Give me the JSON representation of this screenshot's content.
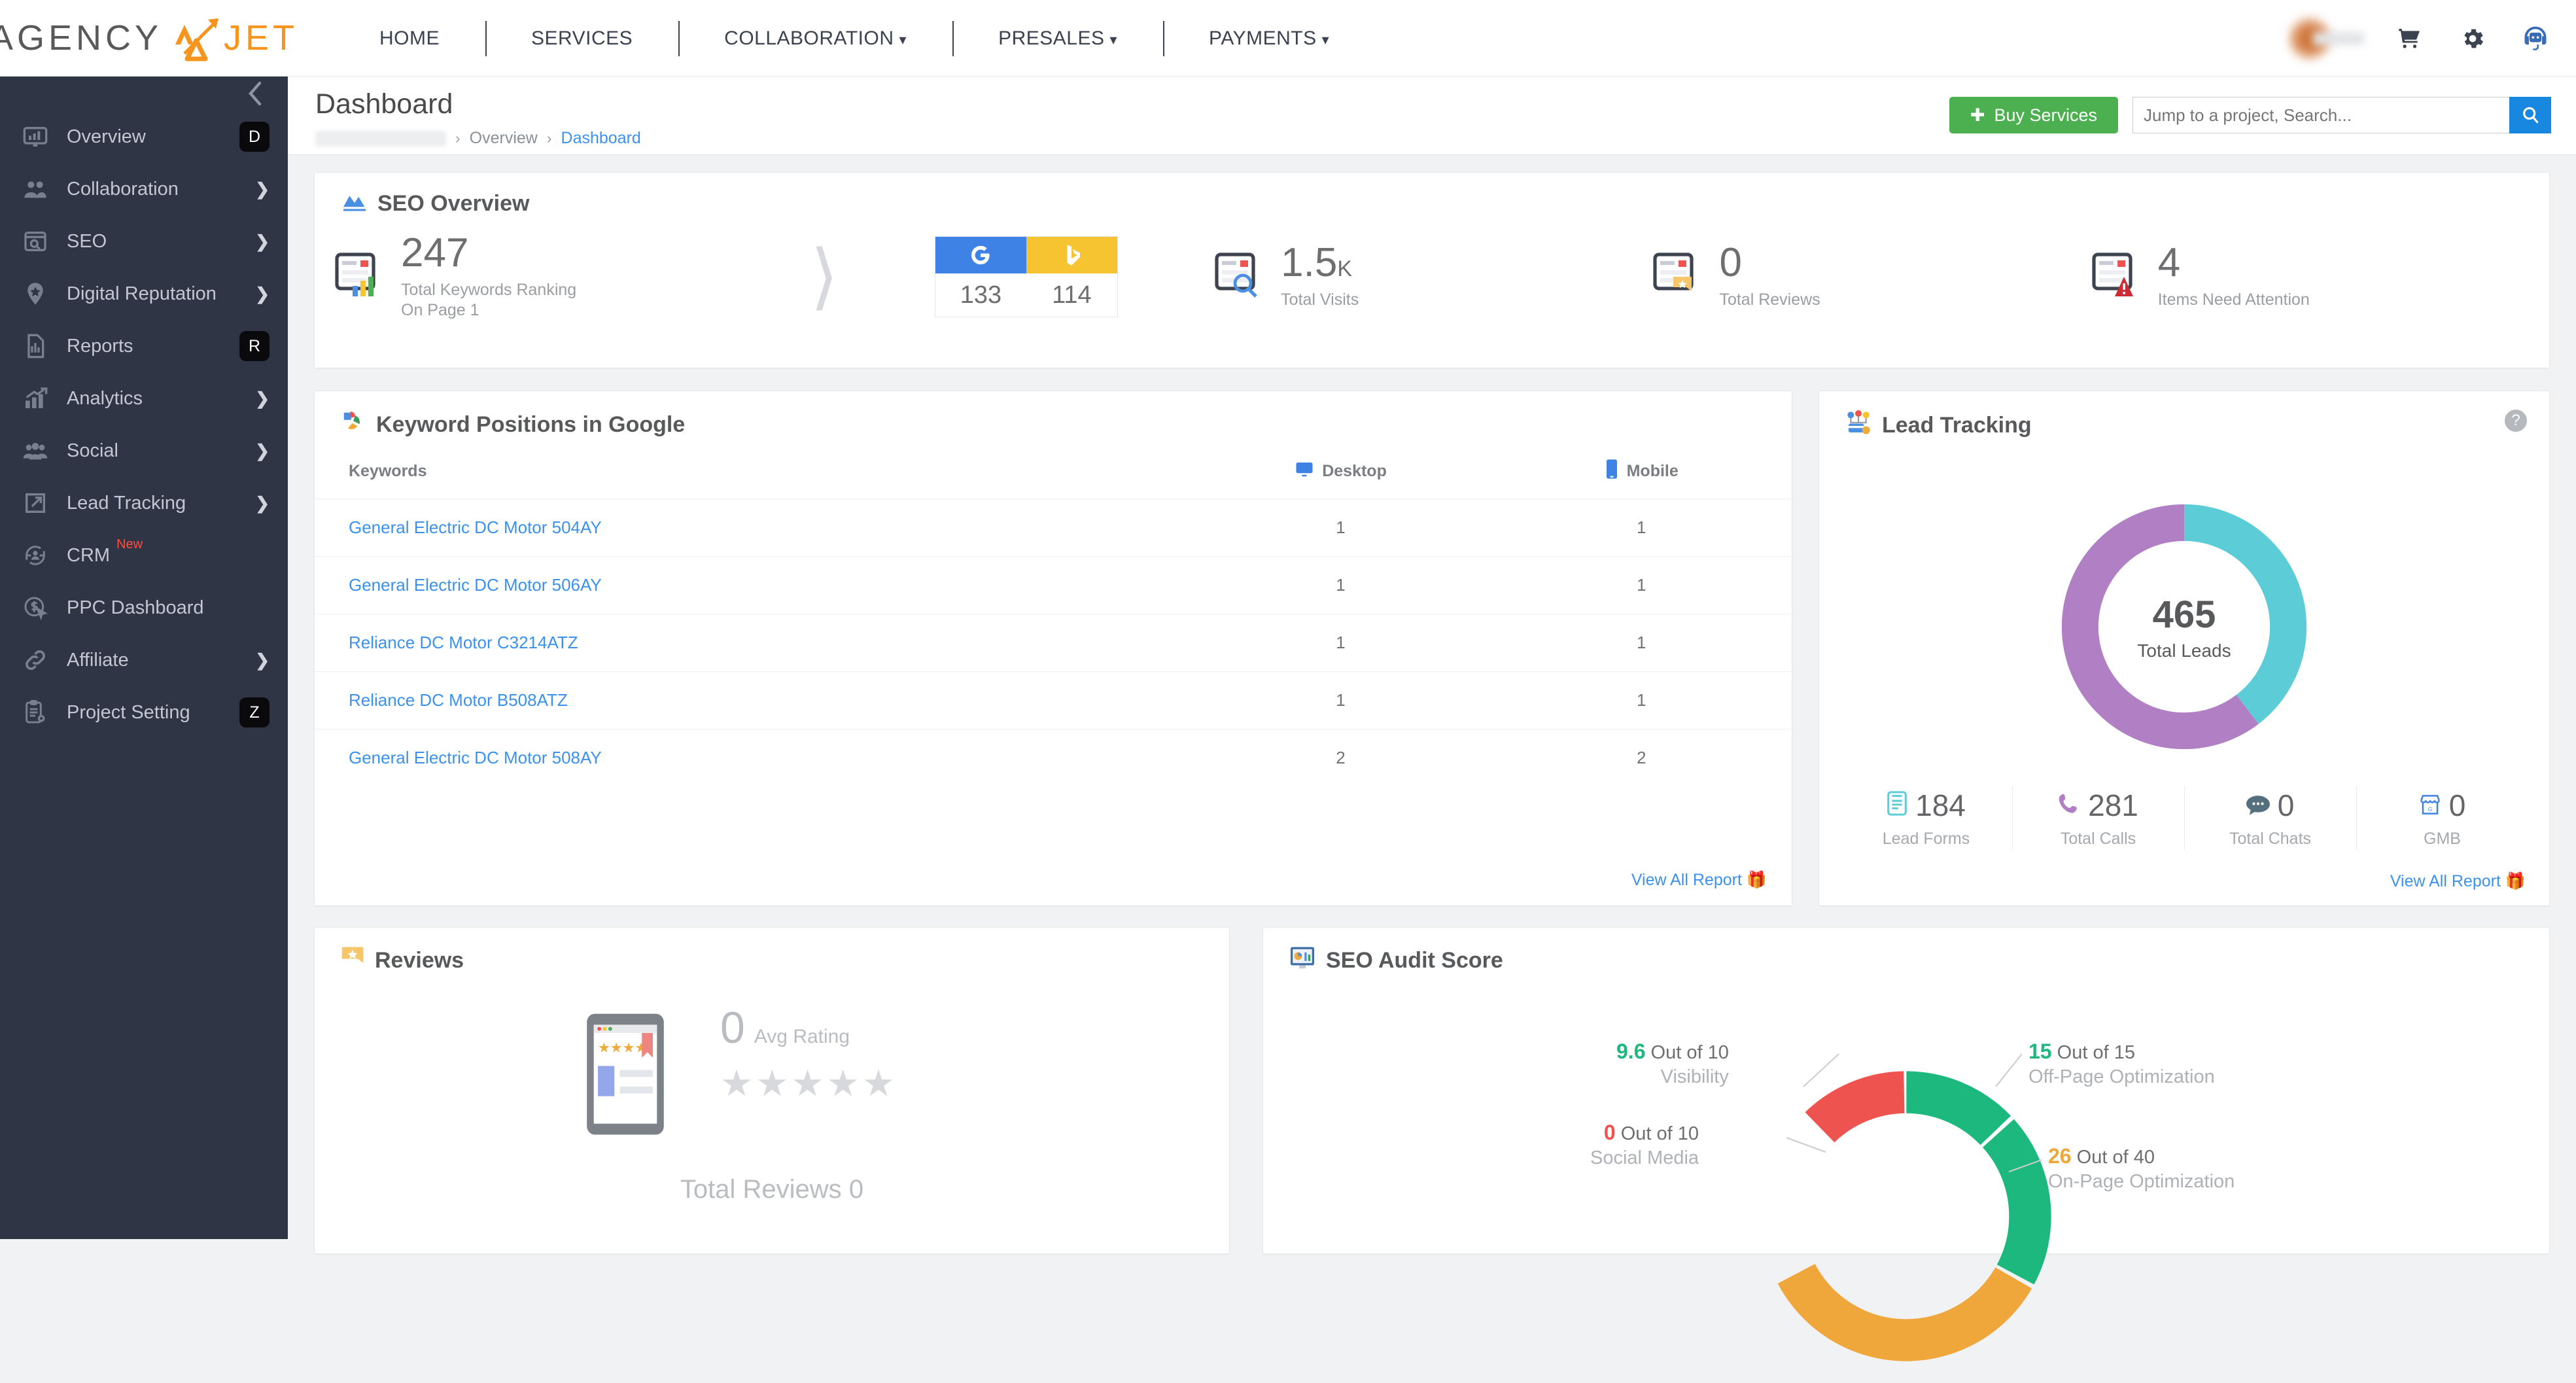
{
  "brand": {
    "name_dark": "AGENCY",
    "name_orange": "JET"
  },
  "topnav": {
    "items": [
      {
        "label": "HOME",
        "has_caret": false
      },
      {
        "label": "SERVICES",
        "has_caret": false
      },
      {
        "label": "COLLABORATION",
        "has_caret": true
      },
      {
        "label": "PRESALES",
        "has_caret": true
      },
      {
        "label": "PAYMENTS",
        "has_caret": true
      }
    ],
    "icons": [
      "cart-icon",
      "gear-icon",
      "support-headset-icon"
    ]
  },
  "sidebar": {
    "collapse_icon": "chevron-left-icon",
    "items": [
      {
        "label": "Overview",
        "icon": "monitor-chart-icon",
        "key": "D",
        "chevron": false
      },
      {
        "label": "Collaboration",
        "icon": "users-icon",
        "key": null,
        "chevron": true
      },
      {
        "label": "SEO",
        "icon": "browser-search-icon",
        "key": null,
        "chevron": true
      },
      {
        "label": "Digital Reputation",
        "icon": "star-pin-icon",
        "key": null,
        "chevron": true
      },
      {
        "label": "Reports",
        "icon": "file-chart-icon",
        "key": "R",
        "chevron": false
      },
      {
        "label": "Analytics",
        "icon": "growth-chart-icon",
        "key": null,
        "chevron": true
      },
      {
        "label": "Social",
        "icon": "group-icon",
        "key": null,
        "chevron": true
      },
      {
        "label": "Lead Tracking",
        "icon": "arrow-out-icon",
        "key": null,
        "chevron": true
      },
      {
        "label": "CRM",
        "icon": "crm-cycle-icon",
        "key": null,
        "chevron": false,
        "badge": "New"
      },
      {
        "label": "PPC Dashboard",
        "icon": "dollar-click-icon",
        "key": null,
        "chevron": false
      },
      {
        "label": "Affiliate",
        "icon": "link-icon",
        "key": null,
        "chevron": true
      },
      {
        "label": "Project Setting",
        "icon": "clipboard-gear-icon",
        "key": "Z",
        "chevron": false
      }
    ]
  },
  "pagehead": {
    "title": "Dashboard",
    "breadcrumb": {
      "project_redacted": "",
      "sep": "›",
      "overview": "Overview",
      "current": "Dashboard"
    },
    "buy_button": "Buy Services",
    "buy_icon": "plus-icon",
    "search": {
      "placeholder": "Jump to a project, Search...",
      "value": "",
      "icon": "search-icon"
    }
  },
  "seo_overview": {
    "title": "SEO Overview",
    "icon": "area-chart-icon",
    "keywords": {
      "value": "247",
      "label_line1": "Total Keywords Ranking",
      "label_line2": "On Page 1",
      "icon": "page-bars-icon"
    },
    "engines": {
      "google": {
        "icon": "google-g-icon",
        "value": "133",
        "color": "#3d82e4"
      },
      "bing": {
        "icon": "bing-b-icon",
        "value": "114",
        "color": "#f5c430"
      }
    },
    "visits": {
      "value": "1.5",
      "unit": "K",
      "label": "Total Visits",
      "icon": "page-search-icon"
    },
    "reviews": {
      "value": "0",
      "label": "Total Reviews",
      "icon": "page-star-icon"
    },
    "attention": {
      "value": "4",
      "label": "Items Need Attention",
      "icon": "page-warning-icon"
    }
  },
  "keyword_card": {
    "title": "Keyword Positions in Google",
    "icon": "google-colored-icon",
    "columns": [
      {
        "label": "Keywords",
        "icon": null
      },
      {
        "label": "Desktop",
        "icon": "desktop-icon"
      },
      {
        "label": "Mobile",
        "icon": "mobile-icon"
      }
    ],
    "rows": [
      {
        "keyword": "General Electric DC Motor 504AY",
        "desktop": "1",
        "mobile": "1"
      },
      {
        "keyword": "General Electric DC Motor 506AY",
        "desktop": "1",
        "mobile": "1"
      },
      {
        "keyword": "Reliance DC Motor C3214ATZ",
        "desktop": "1",
        "mobile": "1"
      },
      {
        "keyword": "Reliance DC Motor B508ATZ",
        "desktop": "1",
        "mobile": "1"
      },
      {
        "keyword": "General Electric DC Motor 508AY",
        "desktop": "2",
        "mobile": "2"
      }
    ],
    "view_all": "View All Report",
    "view_all_icon": "gift-icon"
  },
  "lead_tracking": {
    "title": "Lead Tracking",
    "icon": "lead-funnel-icon",
    "help_icon": "question-mark-icon",
    "total": "465",
    "total_label": "Total Leads",
    "stats": [
      {
        "value": "184",
        "label": "Lead Forms",
        "icon": "form-icon",
        "color": "#5ccdd6"
      },
      {
        "value": "281",
        "label": "Total Calls",
        "icon": "phone-icon",
        "color": "#b07fc4"
      },
      {
        "value": "0",
        "label": "Total Chats",
        "icon": "chat-icon",
        "color": "#54707c"
      },
      {
        "value": "0",
        "label": "GMB",
        "icon": "store-icon",
        "color": "#3d82e4"
      }
    ],
    "view_all": "View All Report",
    "view_all_icon": "gift-icon",
    "chart_data": {
      "type": "pie",
      "title": "Lead Tracking",
      "categories": [
        "Total Calls",
        "Lead Forms"
      ],
      "values": [
        281,
        184
      ],
      "colors": [
        "#b07fc4",
        "#5ccdd6"
      ],
      "center_value": 465,
      "center_label": "Total Leads",
      "legend": "bottom"
    }
  },
  "reviews": {
    "title": "Reviews",
    "icon": "star-badge-icon",
    "device_icon": "phone-review-icon",
    "avg_value": "0",
    "avg_label": "Avg Rating",
    "stars": "★★★★★",
    "total_label": "Total Reviews",
    "total_value": "0"
  },
  "seo_audit": {
    "title": "SEO Audit Score",
    "icon": "monitor-report-icon",
    "chart_data": {
      "type": "pie",
      "title": "SEO Audit Score",
      "categories": [
        "Visibility",
        "Off-Page Optimization",
        "On-Page Optimization",
        "Social Media"
      ],
      "values": [
        9.6,
        15,
        26,
        0
      ],
      "maxes": [
        10,
        15,
        40,
        10
      ],
      "colors": [
        "#1db87d",
        "#1db87d",
        "#efa73b",
        "#ef5350"
      ],
      "legend": "callouts"
    },
    "callouts": [
      {
        "value": "9.6",
        "of": "Out of 10",
        "label": "Visibility",
        "color_key": "v-green"
      },
      {
        "value": "15",
        "of": "Out of 15",
        "label": "Off-Page Optimization",
        "color_key": "v-green"
      },
      {
        "value": "0",
        "of": "Out of 10",
        "label": "Social Media",
        "color_key": "v-red"
      },
      {
        "value": "26",
        "of": "Out of 40",
        "label": "On-Page Optimization",
        "color_key": "v-orange"
      }
    ]
  }
}
